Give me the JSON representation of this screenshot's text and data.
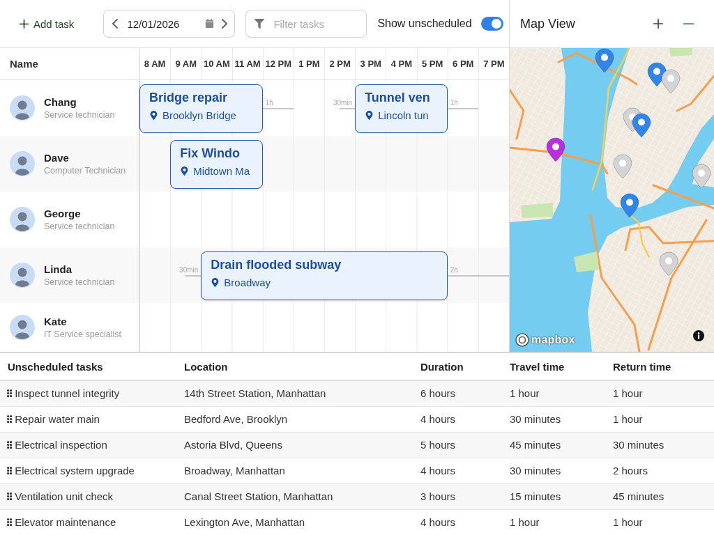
{
  "toolbar": {
    "add_button": {
      "label": "Add task"
    },
    "date_field": {
      "value": "12/01/2026"
    },
    "filter_field": {
      "placeholder": "Filter tasks"
    },
    "show_unscheduled": {
      "label": "Show unscheduled",
      "on": true
    }
  },
  "schedule": {
    "name_header": "Name",
    "hours": [
      "8 AM",
      "9 AM",
      "10 AM",
      "11 AM",
      "12 PM",
      "1 PM",
      "2 PM",
      "3 PM",
      "4 PM",
      "5 PM",
      "6 PM",
      "7 PM"
    ],
    "technicians": [
      {
        "name": "Chang",
        "role": "Service technician",
        "tasks": [
          {
            "title": "Bridge repair",
            "location": "Brooklyn Bridge",
            "travel_after": "1h"
          },
          {
            "title": "Tunnel ven",
            "location": "Lincoln tun",
            "travel_before": "30min",
            "travel_after": "1h"
          }
        ]
      },
      {
        "name": "Dave",
        "role": "Computer Technician",
        "tasks": [
          {
            "title": "Fix Windo",
            "location": "Midtown Ma"
          }
        ]
      },
      {
        "name": "George",
        "role": "Service technician"
      },
      {
        "name": "Linda",
        "role": "Service technician",
        "tasks": [
          {
            "title": "Drain flooded subway",
            "location": "Broadway",
            "travel_before": "30min",
            "travel_after": "2h"
          }
        ]
      },
      {
        "name": "Kate",
        "role": "IT Service specialist"
      }
    ]
  },
  "map_panel": {
    "title": "Map View",
    "markers": [
      {
        "color": "#3085ea"
      },
      {
        "color": "#3085ea"
      },
      {
        "color": "#d4d4d4"
      },
      {
        "color": "#d4d4d4"
      },
      {
        "color": "#3085ea"
      },
      {
        "color": "#b62fe0"
      },
      {
        "color": "#d4d4d4"
      },
      {
        "color": "#d4d4d4"
      },
      {
        "color": "#3085ea"
      },
      {
        "color": "#d4d4d4"
      }
    ],
    "attribution": "mapbox"
  },
  "unscheduled_table": {
    "columns": [
      "Unscheduled tasks",
      "Location",
      "Duration",
      "Travel time",
      "Return time"
    ],
    "rows": [
      [
        "Inspect tunnel integrity",
        "14th Street Station, Manhattan",
        "6 hours",
        "1 hour",
        "1 hour"
      ],
      [
        "Repair water main",
        "Bedford Ave, Brooklyn",
        "4 hours",
        "30 minutes",
        "1 hour"
      ],
      [
        "Electrical inspection",
        "Astoria Blvd, Queens",
        "5 hours",
        "45 minutes",
        "30 minutes"
      ],
      [
        "Electrical system upgrade",
        "Broadway, Manhattan",
        "4 hours",
        "30 minutes",
        "2 hours"
      ],
      [
        "Ventilation unit check",
        "Canal Street Station, Manhattan",
        "3 hours",
        "15 minutes",
        "45 minutes"
      ],
      [
        "Elevator maintenance",
        "Lexington Ave, Manhattan",
        "4 hours",
        "1 hour",
        "1 hour"
      ]
    ]
  }
}
